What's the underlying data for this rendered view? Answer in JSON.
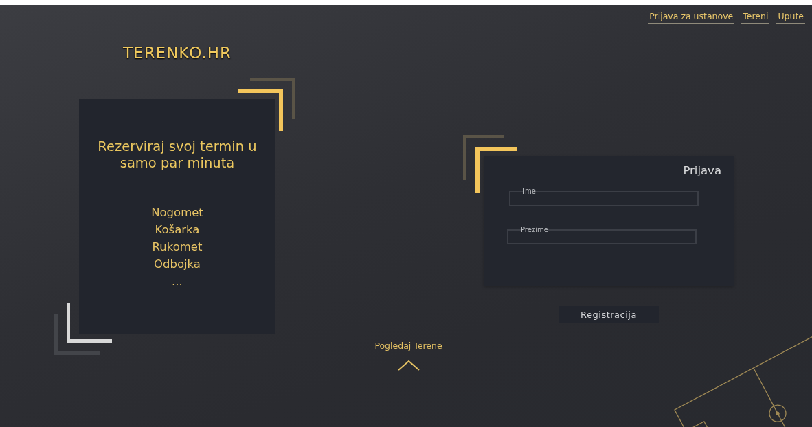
{
  "nav": {
    "links": [
      "Prijava za ustanove",
      "Tereni",
      "Upute"
    ]
  },
  "logo": "TERENKO.HR",
  "promo": {
    "heading": "Rezerviraj svoj termin u samo par minuta",
    "sports": [
      "Nogomet",
      "Košarka",
      "Rukomet",
      "Odbojka",
      "..."
    ]
  },
  "browse_link": "Pogledaj Terene",
  "login": {
    "title": "Prijava",
    "fields": [
      {
        "label": "Ime"
      },
      {
        "label": "Prezime"
      }
    ],
    "button": "Registracija"
  }
}
